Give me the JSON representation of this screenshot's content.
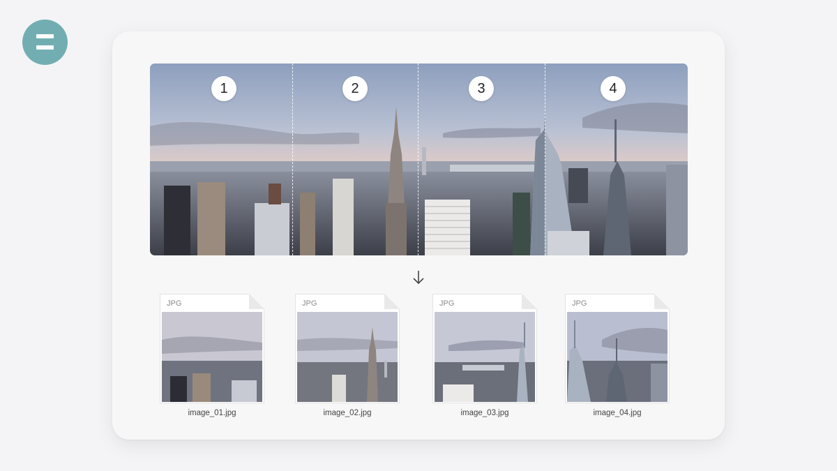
{
  "segments": [
    {
      "number": "1"
    },
    {
      "number": "2"
    },
    {
      "number": "3"
    },
    {
      "number": "4"
    }
  ],
  "files": [
    {
      "type": "JPG",
      "name": "image_01.jpg"
    },
    {
      "type": "JPG",
      "name": "image_02.jpg"
    },
    {
      "type": "JPG",
      "name": "image_03.jpg"
    },
    {
      "type": "JPG",
      "name": "image_04.jpg"
    }
  ],
  "icons": {
    "logo": "menu-icon",
    "arrow": "arrow-down-icon"
  },
  "colors": {
    "logo_bg": "#72aeb1",
    "card_bg": "#f7f7f7",
    "page_bg": "#f4f4f6"
  }
}
